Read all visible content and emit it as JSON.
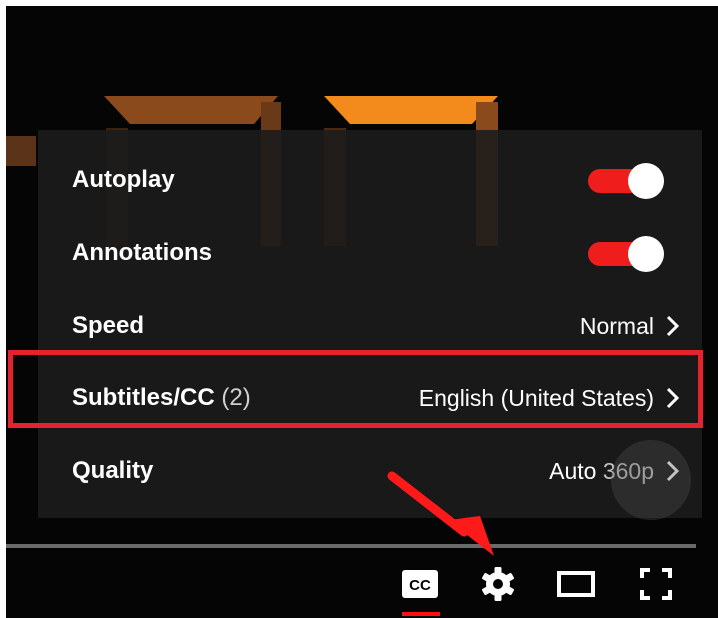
{
  "settings_menu": {
    "items": [
      {
        "label": "Autoplay",
        "type": "toggle",
        "enabled": true
      },
      {
        "label": "Annotations",
        "type": "toggle",
        "enabled": true
      },
      {
        "label": "Speed",
        "type": "select",
        "value": "Normal"
      },
      {
        "label": "Subtitles/CC",
        "count": "(2)",
        "type": "select",
        "value": "English (United States)",
        "highlighted": true
      },
      {
        "label": "Quality",
        "type": "select",
        "value": "Auto",
        "value_extra": "360p"
      }
    ]
  },
  "controls": {
    "icons": [
      "subtitles-cc-icon",
      "settings-gear-icon",
      "theater-mode-icon",
      "fullscreen-icon"
    ],
    "cc_icon_text": "CC"
  },
  "colors": {
    "toggle_on": "#f01d1d",
    "highlight_box": "#e4232e",
    "arrow": "#ff1a1a",
    "cc_active_underline": "#ff1010",
    "digit_orange": "#f28a1c",
    "menu_background": "#1c1c1c"
  }
}
